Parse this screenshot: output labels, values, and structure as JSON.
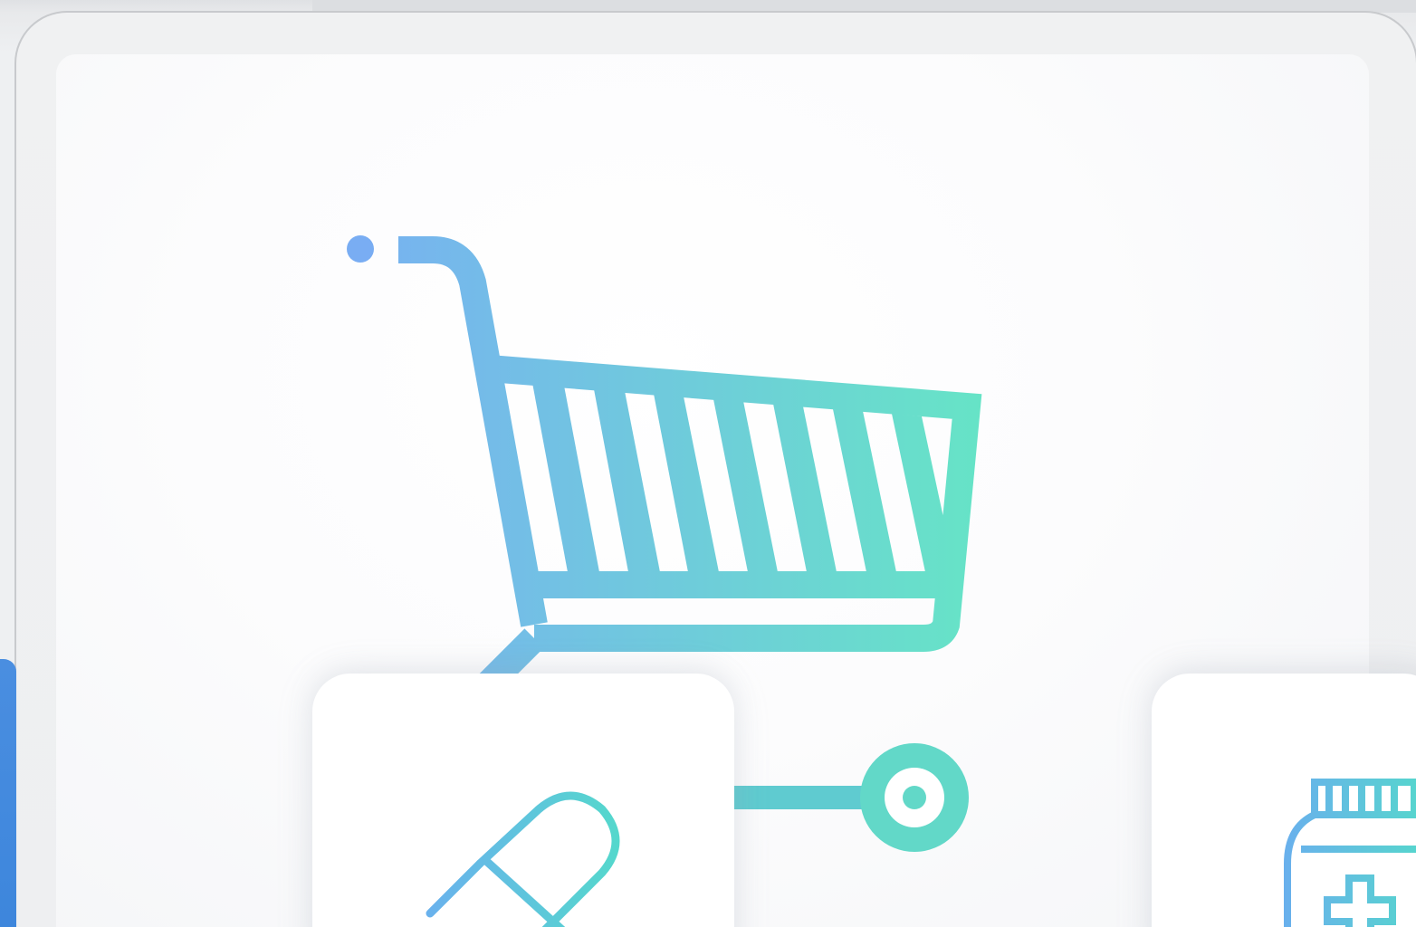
{
  "scene": {
    "colors": {
      "gradient_start": "#78b4f0",
      "gradient_end": "#66e3c8",
      "accent_blue": "#3f88dd",
      "card_bg": "#ffffff",
      "frame_bg": "#eeeff1"
    },
    "icons": {
      "cart": "shopping-cart-icon",
      "pill": "pill-capsule-icon",
      "medicine_bottle": "medicine-bottle-icon",
      "connector": "toggle-connector-icon"
    }
  }
}
